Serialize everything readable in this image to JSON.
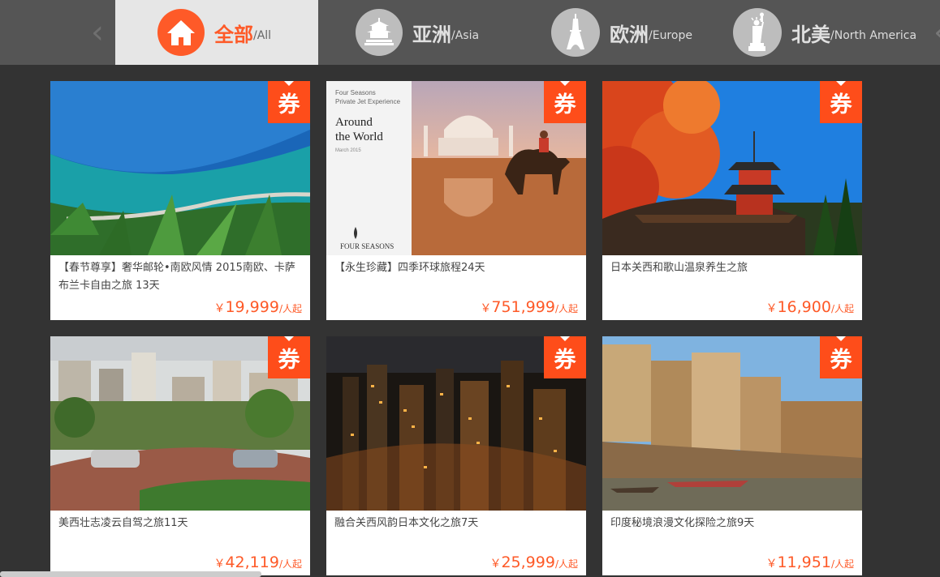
{
  "nav": {
    "prev_arrow": "‹",
    "next_arrow": "‹",
    "tabs": [
      {
        "zh": "全部",
        "en": "/All",
        "icon": "house-icon"
      },
      {
        "zh": "亚洲",
        "en": "/Asia",
        "icon": "temple-icon"
      },
      {
        "zh": "欧洲",
        "en": "/Europe",
        "icon": "eiffel-tower-icon"
      },
      {
        "zh": "北美",
        "en": "/North America",
        "icon": "statue-of-liberty-icon"
      }
    ]
  },
  "badge_label": "券",
  "products": [
    {
      "title": "【春节尊享】奢华邮轮•南欧风情 2015南欧、卡萨布兰卡自由之旅 13天",
      "currency": "￥",
      "price": "19,999",
      "unit": "/人起"
    },
    {
      "title": "【永生珍藏】四季环球旅程24天",
      "currency": "￥",
      "price": "751,999",
      "unit": "/人起"
    },
    {
      "title": "日本关西和歌山温泉养生之旅",
      "currency": "￥",
      "price": "16,900",
      "unit": "/人起"
    },
    {
      "title": "美西壮志凌云自驾之旅11天",
      "currency": "￥",
      "price": "42,119",
      "unit": "/人起"
    },
    {
      "title": "融合关西风韵日本文化之旅7天",
      "currency": "￥",
      "price": "25,999",
      "unit": "/人起"
    },
    {
      "title": "印度秘境浪漫文化探险之旅9天",
      "currency": "￥",
      "price": "11,951",
      "unit": "/人起"
    }
  ],
  "brochure": {
    "line1": "Four Seasons",
    "line2": "Private Jet Experience",
    "heading1": "Around",
    "heading2": "the World",
    "date": "March 2015",
    "brand": "FOUR SEASONS"
  },
  "colors": {
    "accent": "#fe5a28",
    "badge": "#fe4d1a",
    "tabbar": "#555555",
    "background": "#333333"
  }
}
